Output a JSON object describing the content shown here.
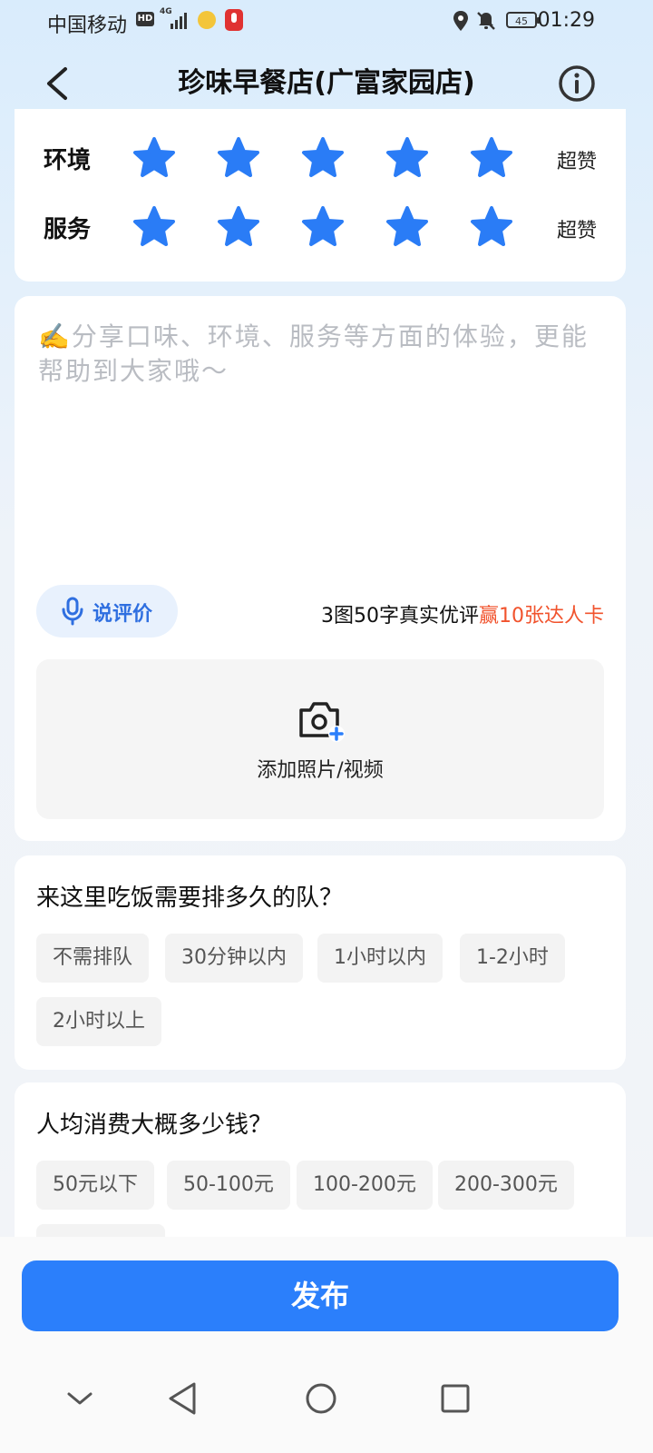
{
  "status": {
    "carrier": "中国移动",
    "hd": "HD",
    "network": "4G",
    "battery": "45",
    "time": "01:29"
  },
  "header": {
    "title": "珍味早餐店(广富家园店)"
  },
  "ratings": [
    {
      "label": "环境",
      "stars": 5,
      "text": "超赞"
    },
    {
      "label": "服务",
      "stars": 5,
      "text": "超赞"
    }
  ],
  "review": {
    "placeholder": "✍️分享口味、环境、服务等方面的体验，更能帮助到大家哦～",
    "voice_label": "说评价",
    "promo_text": "3图50字真实优评",
    "promo_highlight": "赢10张达人卡",
    "upload_label": "添加照片/视频"
  },
  "questions": [
    {
      "title": "来这里吃饭需要排多久的队？",
      "options": [
        "不需排队",
        "30分钟以内",
        "1小时以内",
        "1-2小时",
        "2小时以上"
      ]
    },
    {
      "title": "人均消费大概多少钱？",
      "options": [
        "50元以下",
        "50-100元",
        "100-200元",
        "200-300元",
        ""
      ]
    }
  ],
  "publish_label": "发布",
  "colors": {
    "accent": "#2b7ffb",
    "star": "#2a7cf6",
    "highlight": "#f1532d"
  }
}
